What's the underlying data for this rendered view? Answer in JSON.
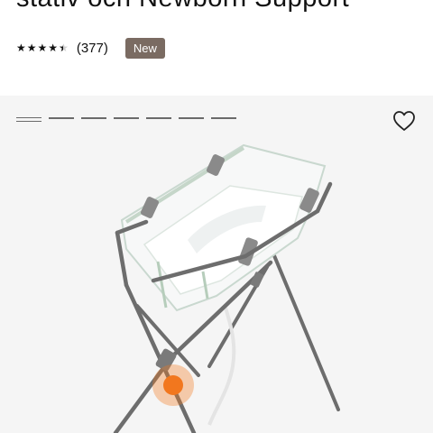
{
  "product": {
    "title": "stativ och Newborn Support",
    "rating_text": "(377)",
    "badge": "New"
  },
  "gallery": {
    "indicator_count": 7,
    "active_index": 0
  },
  "icons": {
    "favorite": "heart-outline-icon",
    "star": "star-icon",
    "star_half": "star-half-icon"
  },
  "colors": {
    "badge_bg": "#7a6b62",
    "hotspot": "#f2771e",
    "gallery_bg": "#f5f5f5"
  }
}
